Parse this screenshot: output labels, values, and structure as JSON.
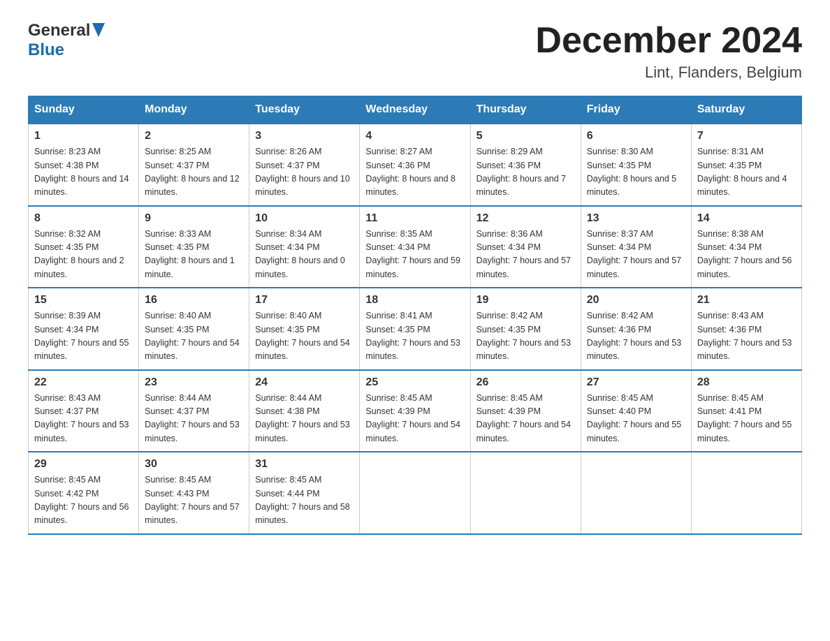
{
  "header": {
    "logo_general": "General",
    "logo_blue": "Blue",
    "month_title": "December 2024",
    "location": "Lint, Flanders, Belgium"
  },
  "weekdays": [
    "Sunday",
    "Monday",
    "Tuesday",
    "Wednesday",
    "Thursday",
    "Friday",
    "Saturday"
  ],
  "weeks": [
    [
      {
        "day": "1",
        "sunrise": "8:23 AM",
        "sunset": "4:38 PM",
        "daylight": "8 hours and 14 minutes."
      },
      {
        "day": "2",
        "sunrise": "8:25 AM",
        "sunset": "4:37 PM",
        "daylight": "8 hours and 12 minutes."
      },
      {
        "day": "3",
        "sunrise": "8:26 AM",
        "sunset": "4:37 PM",
        "daylight": "8 hours and 10 minutes."
      },
      {
        "day": "4",
        "sunrise": "8:27 AM",
        "sunset": "4:36 PM",
        "daylight": "8 hours and 8 minutes."
      },
      {
        "day": "5",
        "sunrise": "8:29 AM",
        "sunset": "4:36 PM",
        "daylight": "8 hours and 7 minutes."
      },
      {
        "day": "6",
        "sunrise": "8:30 AM",
        "sunset": "4:35 PM",
        "daylight": "8 hours and 5 minutes."
      },
      {
        "day": "7",
        "sunrise": "8:31 AM",
        "sunset": "4:35 PM",
        "daylight": "8 hours and 4 minutes."
      }
    ],
    [
      {
        "day": "8",
        "sunrise": "8:32 AM",
        "sunset": "4:35 PM",
        "daylight": "8 hours and 2 minutes."
      },
      {
        "day": "9",
        "sunrise": "8:33 AM",
        "sunset": "4:35 PM",
        "daylight": "8 hours and 1 minute."
      },
      {
        "day": "10",
        "sunrise": "8:34 AM",
        "sunset": "4:34 PM",
        "daylight": "8 hours and 0 minutes."
      },
      {
        "day": "11",
        "sunrise": "8:35 AM",
        "sunset": "4:34 PM",
        "daylight": "7 hours and 59 minutes."
      },
      {
        "day": "12",
        "sunrise": "8:36 AM",
        "sunset": "4:34 PM",
        "daylight": "7 hours and 57 minutes."
      },
      {
        "day": "13",
        "sunrise": "8:37 AM",
        "sunset": "4:34 PM",
        "daylight": "7 hours and 57 minutes."
      },
      {
        "day": "14",
        "sunrise": "8:38 AM",
        "sunset": "4:34 PM",
        "daylight": "7 hours and 56 minutes."
      }
    ],
    [
      {
        "day": "15",
        "sunrise": "8:39 AM",
        "sunset": "4:34 PM",
        "daylight": "7 hours and 55 minutes."
      },
      {
        "day": "16",
        "sunrise": "8:40 AM",
        "sunset": "4:35 PM",
        "daylight": "7 hours and 54 minutes."
      },
      {
        "day": "17",
        "sunrise": "8:40 AM",
        "sunset": "4:35 PM",
        "daylight": "7 hours and 54 minutes."
      },
      {
        "day": "18",
        "sunrise": "8:41 AM",
        "sunset": "4:35 PM",
        "daylight": "7 hours and 53 minutes."
      },
      {
        "day": "19",
        "sunrise": "8:42 AM",
        "sunset": "4:35 PM",
        "daylight": "7 hours and 53 minutes."
      },
      {
        "day": "20",
        "sunrise": "8:42 AM",
        "sunset": "4:36 PM",
        "daylight": "7 hours and 53 minutes."
      },
      {
        "day": "21",
        "sunrise": "8:43 AM",
        "sunset": "4:36 PM",
        "daylight": "7 hours and 53 minutes."
      }
    ],
    [
      {
        "day": "22",
        "sunrise": "8:43 AM",
        "sunset": "4:37 PM",
        "daylight": "7 hours and 53 minutes."
      },
      {
        "day": "23",
        "sunrise": "8:44 AM",
        "sunset": "4:37 PM",
        "daylight": "7 hours and 53 minutes."
      },
      {
        "day": "24",
        "sunrise": "8:44 AM",
        "sunset": "4:38 PM",
        "daylight": "7 hours and 53 minutes."
      },
      {
        "day": "25",
        "sunrise": "8:45 AM",
        "sunset": "4:39 PM",
        "daylight": "7 hours and 54 minutes."
      },
      {
        "day": "26",
        "sunrise": "8:45 AM",
        "sunset": "4:39 PM",
        "daylight": "7 hours and 54 minutes."
      },
      {
        "day": "27",
        "sunrise": "8:45 AM",
        "sunset": "4:40 PM",
        "daylight": "7 hours and 55 minutes."
      },
      {
        "day": "28",
        "sunrise": "8:45 AM",
        "sunset": "4:41 PM",
        "daylight": "7 hours and 55 minutes."
      }
    ],
    [
      {
        "day": "29",
        "sunrise": "8:45 AM",
        "sunset": "4:42 PM",
        "daylight": "7 hours and 56 minutes."
      },
      {
        "day": "30",
        "sunrise": "8:45 AM",
        "sunset": "4:43 PM",
        "daylight": "7 hours and 57 minutes."
      },
      {
        "day": "31",
        "sunrise": "8:45 AM",
        "sunset": "4:44 PM",
        "daylight": "7 hours and 58 minutes."
      },
      null,
      null,
      null,
      null
    ]
  ],
  "labels": {
    "sunrise": "Sunrise:",
    "sunset": "Sunset:",
    "daylight": "Daylight:"
  }
}
